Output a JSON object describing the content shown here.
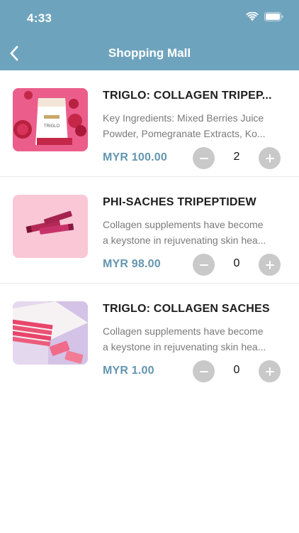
{
  "status": {
    "time": "4:33"
  },
  "nav": {
    "title": "Shopping Mall",
    "back_icon": "chevron-left-icon"
  },
  "colors": {
    "header": "#6ea3bd",
    "price": "#6396b1",
    "stepper": "#c9c9c9"
  },
  "products": [
    {
      "title": "TRIGLO: COLLAGEN TRIPEP...",
      "desc_line1": "Key Ingredients: Mixed Berries Juice",
      "desc_line2": "Powder, Pomegranate Extracts, Ko...",
      "price": "MYR 100.00",
      "quantity": "2",
      "thumb_label": "TRIGLO"
    },
    {
      "title": "PHI-SACHES TRIPEPTIDEW",
      "desc_line1": "Collagen supplements have become",
      "desc_line2": "a keystone in rejuvenating skin hea...",
      "price": "MYR 98.00",
      "quantity": "0"
    },
    {
      "title": "TRIGLO: COLLAGEN SACHES",
      "desc_line1": "Collagen supplements have become",
      "desc_line2": "a keystone in rejuvenating skin hea...",
      "price": "MYR 1.00",
      "quantity": "0"
    }
  ]
}
